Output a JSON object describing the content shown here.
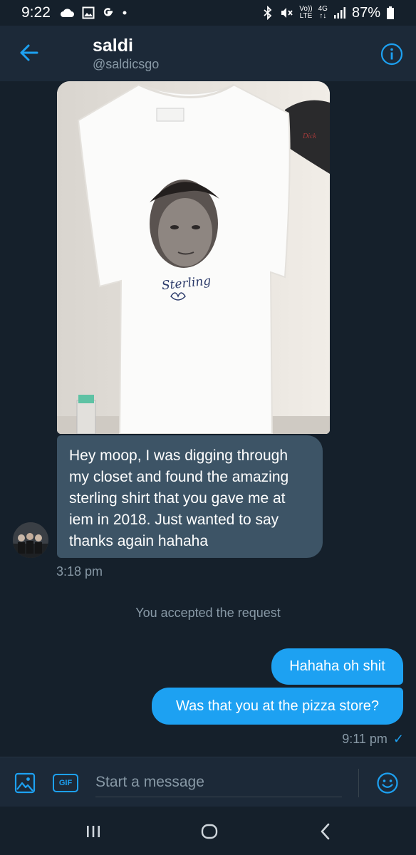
{
  "status_bar": {
    "time": "9:22",
    "left_icons": [
      "cloud-icon",
      "image-icon",
      "google-icon",
      "dot-icon"
    ],
    "volte_top": "Vo))",
    "volte_bottom": "LTE",
    "net_top": "4G",
    "net_bottom": "↑↓",
    "battery": "87%"
  },
  "header": {
    "name": "saldi",
    "handle": "@saldicsgo"
  },
  "messages": {
    "photo_caption": "Sterling",
    "incoming_text": "Hey moop, I was digging through my closet and found the amazing sterling shirt that you gave me at iem in 2018. Just wanted to say thanks again hahaha",
    "incoming_time": "3:18 pm",
    "system_text": "You accepted the request",
    "outgoing": [
      "Hahaha oh shit",
      "Was that you at the pizza store?"
    ],
    "outgoing_time": "9:11 pm",
    "read_mark": "✓"
  },
  "composer": {
    "placeholder": "Start a message",
    "gif_label": "GIF"
  },
  "colors": {
    "background": "#15202b",
    "header": "#1c2938",
    "incoming_bubble": "#3d5466",
    "outgoing_bubble": "#1da1f2",
    "accent": "#1da1f2",
    "muted_text": "#8899a6"
  }
}
